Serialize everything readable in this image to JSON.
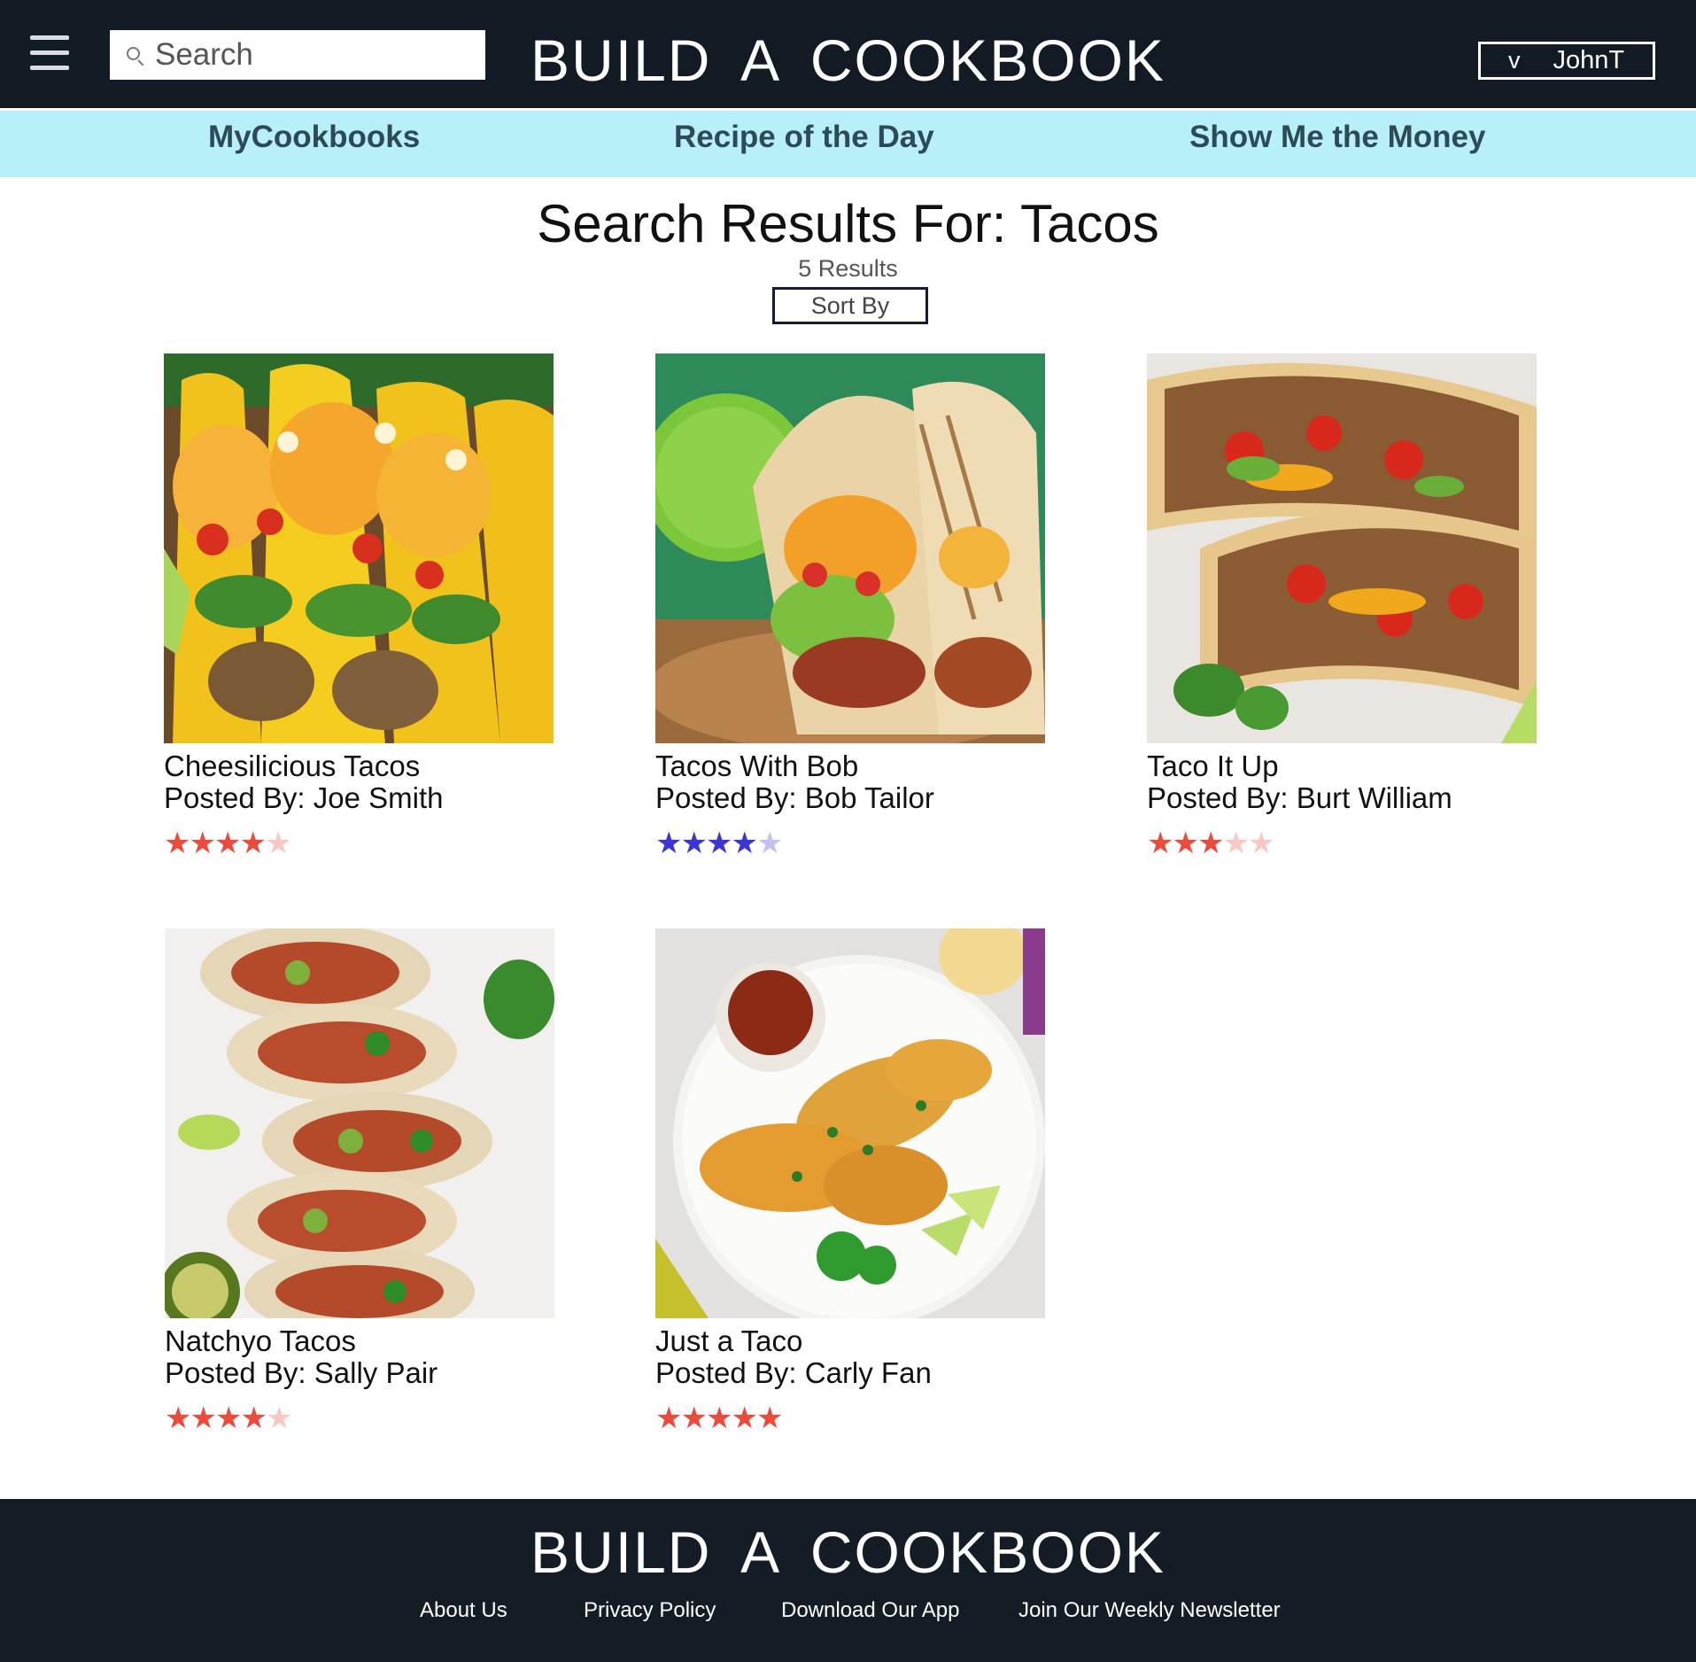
{
  "header": {
    "brand": "BUILD A COOKBOOK",
    "search_placeholder": "Search",
    "user_chevron": "v",
    "user_name": "JohnT"
  },
  "nav": {
    "items": [
      "MyCookbooks",
      "Recipe of the Day",
      "Show Me the Money"
    ]
  },
  "results": {
    "heading": "Search Results For: Tacos",
    "count": "5 Results",
    "sort_label": "Sort By"
  },
  "recipes": [
    {
      "title": "Cheesilicious Tacos",
      "author": "Posted By: Joe Smith",
      "rating": 4,
      "max_rating": 5,
      "star_color": "#ec4b3c",
      "image": "hard-shell-tacos-photo"
    },
    {
      "title": "Tacos With Bob",
      "author": "Posted By: Bob Tailor",
      "rating": 4,
      "max_rating": 5,
      "star_color": "#3b35d6",
      "image": "soft-tacos-with-lime-photo"
    },
    {
      "title": "Taco It Up",
      "author": "Posted By: Burt William",
      "rating": 3,
      "max_rating": 5,
      "star_color": "#ec4b3c",
      "image": "ground-beef-tacos-photo"
    },
    {
      "title": "Natchyo Tacos",
      "author": "Posted By: Sally Pair",
      "rating": 4,
      "max_rating": 5,
      "star_color": "#ec4b3c",
      "image": "avocado-jalapeno-tacos-photo"
    },
    {
      "title": "Just a Taco",
      "author": "Posted By: Carly Fan",
      "rating": 5,
      "max_rating": 5,
      "star_color": "#ec4b3c",
      "image": "birria-tacos-plate-photo"
    }
  ],
  "footer": {
    "brand": "BUILD A COOKBOOK",
    "links": [
      "About Us",
      "Privacy Policy",
      "Download Our App",
      "Join Our Weekly Newsletter"
    ]
  },
  "colors": {
    "header_bg": "#121b24",
    "nav_bg": "#b7f0f8",
    "nav_text": "#2c4a58",
    "footer_bg": "#141d26"
  }
}
